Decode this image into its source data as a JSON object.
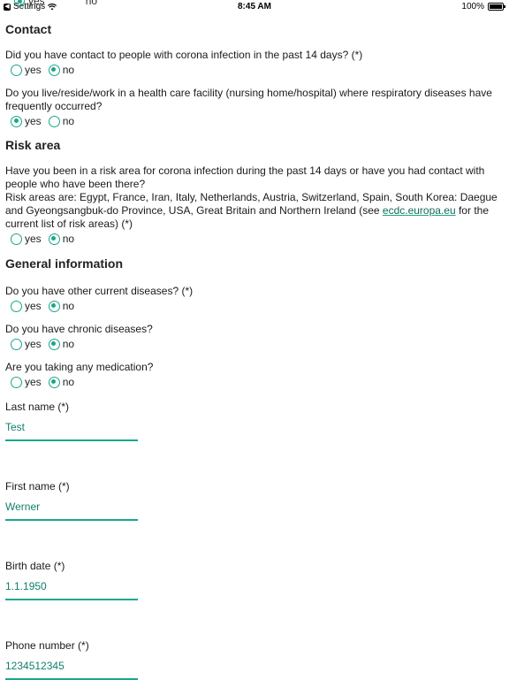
{
  "statusbar": {
    "back_label": "Settings",
    "time": "8:45 AM",
    "battery": "100%",
    "battery_level": 1.0
  },
  "ghost": {
    "yes": "yes",
    "no": "no"
  },
  "sections": {
    "contact": "Contact",
    "risk": "Risk area",
    "general": "General information"
  },
  "questions": {
    "q1": "Did you have contact to people with corona infection in the past 14 days? (*)",
    "q2": "Do you live/reside/work in a health care facility (nursing home/hospital) where respiratory diseases have frequently occurred?",
    "q3_part1": "Have you been in a risk area for corona infection during the past 14 days or have you had contact with people who have been there?",
    "q3_part2": "Risk areas are: Egypt, France, Iran, Italy, Netherlands, Austria, Switzerland, Spain, South Korea: Daegue and Gyeongsangbuk-do Province, USA, Great Britain and Northern Ireland (see ",
    "q3_link": "ecdc.europa.eu",
    "q3_part3": " for the current list of risk areas) (*)",
    "q4": "Do you have other current diseases? (*)",
    "q5": "Do you have chronic diseases?",
    "q6": "Are you taking any medication?"
  },
  "options": {
    "yes": "yes",
    "no": "no"
  },
  "fields": {
    "last_name": {
      "label": "Last name (*)",
      "value": "Test"
    },
    "first_name": {
      "label": "First name (*)",
      "value": "Werner"
    },
    "birth_date": {
      "label": "Birth date (*)",
      "value": "1.1.1950"
    },
    "phone": {
      "label": "Phone number (*)",
      "value": "1234512345"
    }
  }
}
